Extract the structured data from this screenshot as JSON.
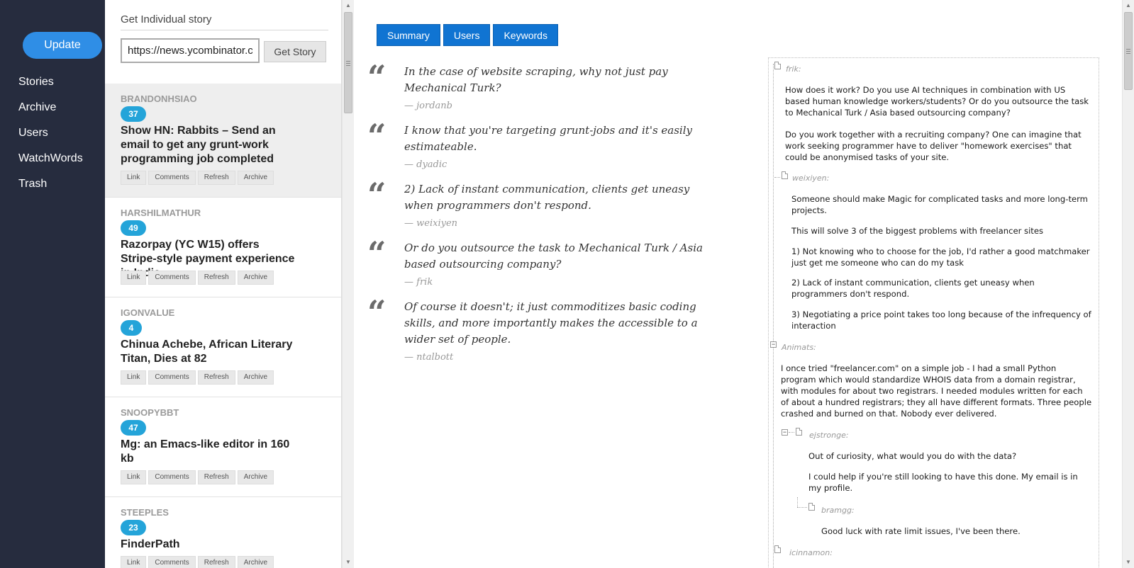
{
  "nav": {
    "update_label": "Update",
    "items": [
      {
        "label": "Stories"
      },
      {
        "label": "Archive"
      },
      {
        "label": "Users"
      },
      {
        "label": "WatchWords"
      },
      {
        "label": "Trash"
      }
    ]
  },
  "story_panel": {
    "title": "Get Individual story",
    "url_value": "https://news.ycombinator.c",
    "get_story_label": "Get Story"
  },
  "stories": [
    {
      "author": "BRANDONHSIAO",
      "count": "37",
      "title": "Show HN: Rabbits – Send an email to get any grunt-work programming job completed",
      "actions": [
        "Link",
        "Comments",
        "Refresh",
        "Archive"
      ]
    },
    {
      "author": "HARSHILMATHUR",
      "count": "49",
      "title": "Razorpay (YC W15) offers Stripe-style payment experience in India",
      "actions": [
        "Link",
        "Comments",
        "Refresh",
        "Archive"
      ]
    },
    {
      "author": "IGONVALUE",
      "count": "4",
      "title": "Chinua Achebe, African Literary Titan, Dies at 82",
      "actions": [
        "Link",
        "Comments",
        "Refresh",
        "Archive"
      ]
    },
    {
      "author": "SNOOPYBBT",
      "count": "47",
      "title": "Mg: an Emacs-like editor in 160 kb",
      "actions": [
        "Link",
        "Comments",
        "Refresh",
        "Archive"
      ]
    },
    {
      "author": "STEEPLES",
      "count": "23",
      "title": "FinderPath",
      "actions": [
        "Link",
        "Comments",
        "Refresh",
        "Archive"
      ]
    }
  ],
  "tabs": [
    "Summary",
    "Users",
    "Keywords"
  ],
  "quotes": [
    {
      "text": "In the case of website scraping, why not just pay Mechanical Turk?",
      "by": "— jordanb"
    },
    {
      "text": "I know that you're targeting grunt-jobs and it's easily estimateable.",
      "by": "— dyadic"
    },
    {
      "text": "2) Lack of instant communication, clients get uneasy when programmers don't respond.",
      "by": "— weixiyen"
    },
    {
      "text": "Or do you outsource the task to Mechanical Turk / Asia based outsourcing company?",
      "by": "— frik"
    },
    {
      "text": "Of course it doesn't; it just commoditizes basic coding skills, and more importantly makes the accessible to a wider set of people.",
      "by": "— ntalbott"
    }
  ],
  "quote_mark": "“",
  "comments": {
    "frik": {
      "author": "frik:",
      "p1": "How does it work? Do you use AI techniques in combination with US based human knowledge workers/students? Or do you outsource the task to Mechanical Turk / Asia based outsourcing company?",
      "p2": "Do you work together with a recruiting company? One can imagine that work seeking programmer have to deliver \"homework exercises\" that could be anonymised tasks of your site."
    },
    "weixiyen": {
      "author": "weixiyen:",
      "p1": "Someone should make Magic for complicated tasks and more long-term projects.",
      "p2": "This will solve 3 of the biggest problems with freelancer sites",
      "p3": "1) Not knowing who to choose for the job, I'd rather a good matchmaker just get me someone who can do my task",
      "p4": "2) Lack of instant communication, clients get uneasy when programmers don't respond.",
      "p5": "3) Negotiating a price point takes too long because of the infrequency of interaction"
    },
    "animats": {
      "author": "Animats:",
      "p1": "I once tried \"freelancer.com\" on a simple job - I had a small Python program which would standardize WHOIS data from a domain registrar, with modules for about two registrars. I needed modules written for each of about a hundred registrars; they all have different formats. Three people crashed and burned on that. Nobody ever delivered."
    },
    "ejstronge": {
      "author": "ejstronge:",
      "p1": "Out of curiosity, what would you do with the data?",
      "p2": "I could help if you're still looking to have this done. My email is in my profile."
    },
    "bramgg": {
      "author": "bramgg:",
      "p1": "Good luck with rate limit issues, I've been there."
    },
    "icinnamon": {
      "author": "icinnamon:"
    }
  },
  "tree_toggle": "−",
  "scroll_arrows": {
    "up": "▲",
    "down": "▼"
  }
}
